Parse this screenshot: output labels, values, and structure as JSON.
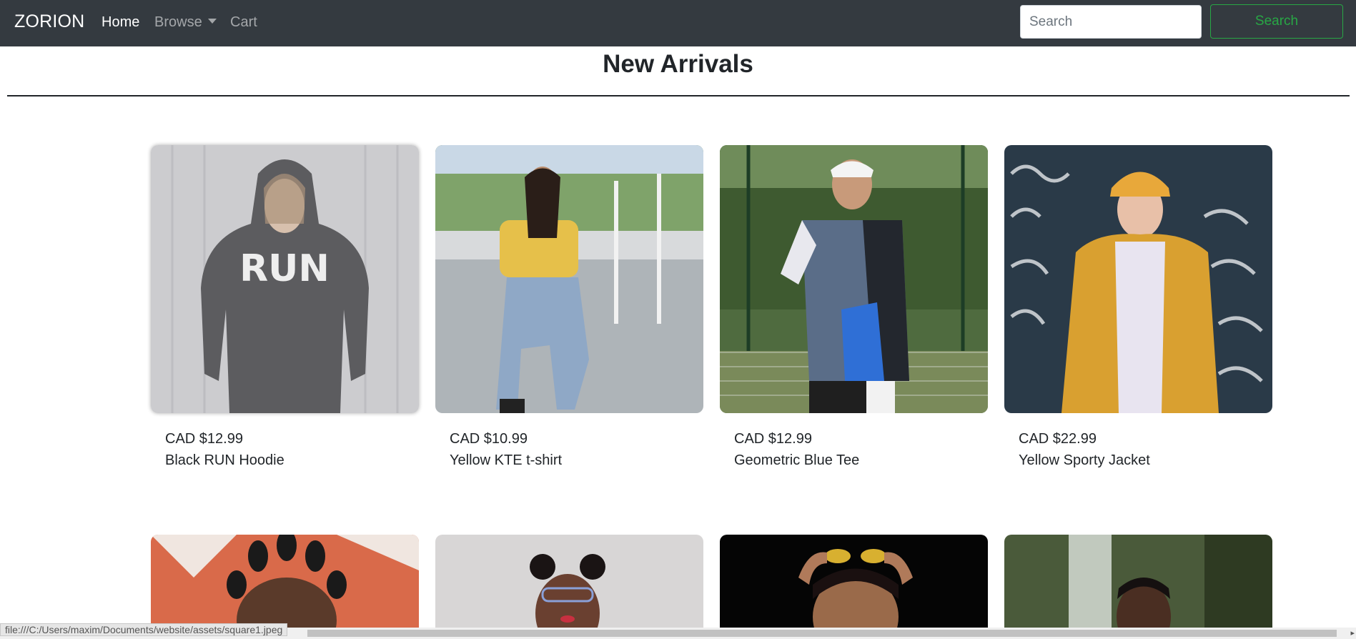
{
  "navbar": {
    "brand": "ZORION",
    "links": [
      {
        "label": "Home",
        "active": true
      },
      {
        "label": "Browse",
        "dropdown": true
      },
      {
        "label": "Cart"
      }
    ],
    "search_placeholder": "Search",
    "search_button": "Search"
  },
  "page": {
    "title": "New Arrivals"
  },
  "products": [
    {
      "price": "CAD $12.99",
      "name": "Black RUN Hoodie",
      "image_print": "RUN"
    },
    {
      "price": "CAD $10.99",
      "name": "Yellow KTE t-shirt"
    },
    {
      "price": "CAD $12.99",
      "name": "Geometric Blue Tee"
    },
    {
      "price": "CAD $22.99",
      "name": "Yellow Sporty Jacket"
    }
  ],
  "status_bar": {
    "url": "file:///C:/Users/maxim/Documents/website/assets/square1.jpeg"
  },
  "colors": {
    "navbar_bg": "#343a40",
    "search_button_accent": "#28a745"
  }
}
